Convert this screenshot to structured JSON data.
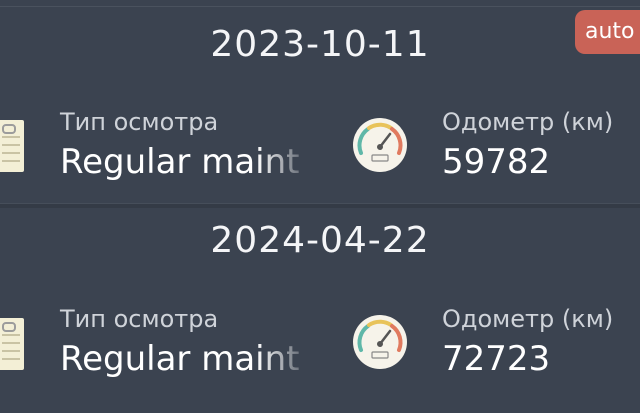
{
  "badge": {
    "label": "auto"
  },
  "records": [
    {
      "date": "2023-10-11",
      "type_label": "Тип осмотра",
      "type_value": "Regular maint",
      "odometer_label": "Одометр (км)",
      "odometer_value": "59782"
    },
    {
      "date": "2024-04-22",
      "type_label": "Тип осмотра",
      "type_value": "Regular maint",
      "odometer_label": "Одометр (км)",
      "odometer_value": "72723"
    }
  ],
  "icons": {
    "record_icon": "notepad-icon",
    "odometer_icon": "speedometer-icon"
  },
  "colors": {
    "background": "#3b4350",
    "badge": "#c96357",
    "text_primary": "#ffffff",
    "text_secondary": "#cfd3d9"
  }
}
